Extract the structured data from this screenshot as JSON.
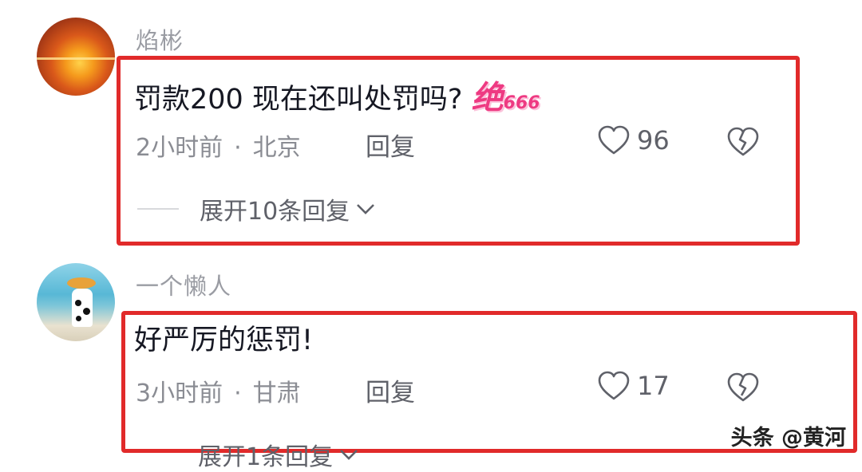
{
  "comments": [
    {
      "username": "焰彬",
      "text": "罚款200 现在还叫处罚吗?",
      "decoration": "绝",
      "decoration_small": "666",
      "time": "2小时前",
      "separator": "·",
      "location": "北京",
      "reply_label": "回复",
      "likes": "96",
      "expand_label": "展开10条回复"
    },
    {
      "username": "一个懒人",
      "text": "好严厉的惩罚!",
      "time": "3小时前",
      "separator": "·",
      "location": "甘肃",
      "reply_label": "回复",
      "likes": "17",
      "expand_label": "展开1条回复"
    }
  ],
  "watermark": "头条 @黄河",
  "colors": {
    "highlight_border": "#e12a2a",
    "username": "#9a9ca3",
    "meta": "#8a8c93",
    "decoration": "#ee3a82"
  },
  "icons": [
    "heart-outline-icon",
    "broken-heart-icon",
    "chevron-down-icon"
  ]
}
